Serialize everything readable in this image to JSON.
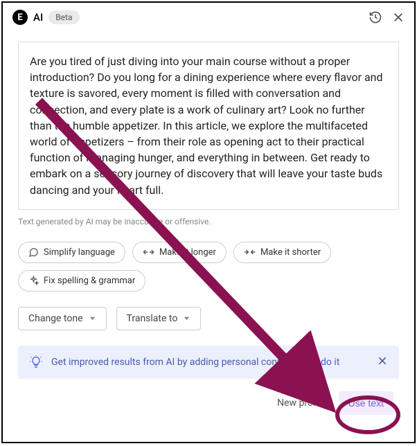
{
  "header": {
    "logo_char": "E",
    "title": "AI",
    "badge": "Beta"
  },
  "main": {
    "textarea_value": "Are you tired of just diving into your main course without a proper introduction? Do you long for a dining experience where every flavor and texture is savored, every moment is filled with conversation and connection, and every plate is a work of culinary art? Look no further than the humble appetizer. In this article, we explore the multifaceted world of appetizers – from their role as opening act to their practical function of managing hunger, and everything in between. Get ready to embark on a sensory journey of discovery that will leave your taste buds dancing and your heart full.",
    "disclaimer": "Text generated by AI may be inaccurate or offensive."
  },
  "chips": {
    "simplify": "Simplify language",
    "longer": "Make it longer",
    "shorter": "Make it shorter",
    "grammar": "Fix spelling & grammar"
  },
  "dropdowns": {
    "tone": "Change tone",
    "translate": "Translate to"
  },
  "banner": {
    "text": "Get improved results from AI by adding personal context.",
    "link": "Let's do it"
  },
  "footer": {
    "new_prompt": "New prompt",
    "use_text": "Use text"
  },
  "annotation": {
    "color": "#8a1250"
  }
}
